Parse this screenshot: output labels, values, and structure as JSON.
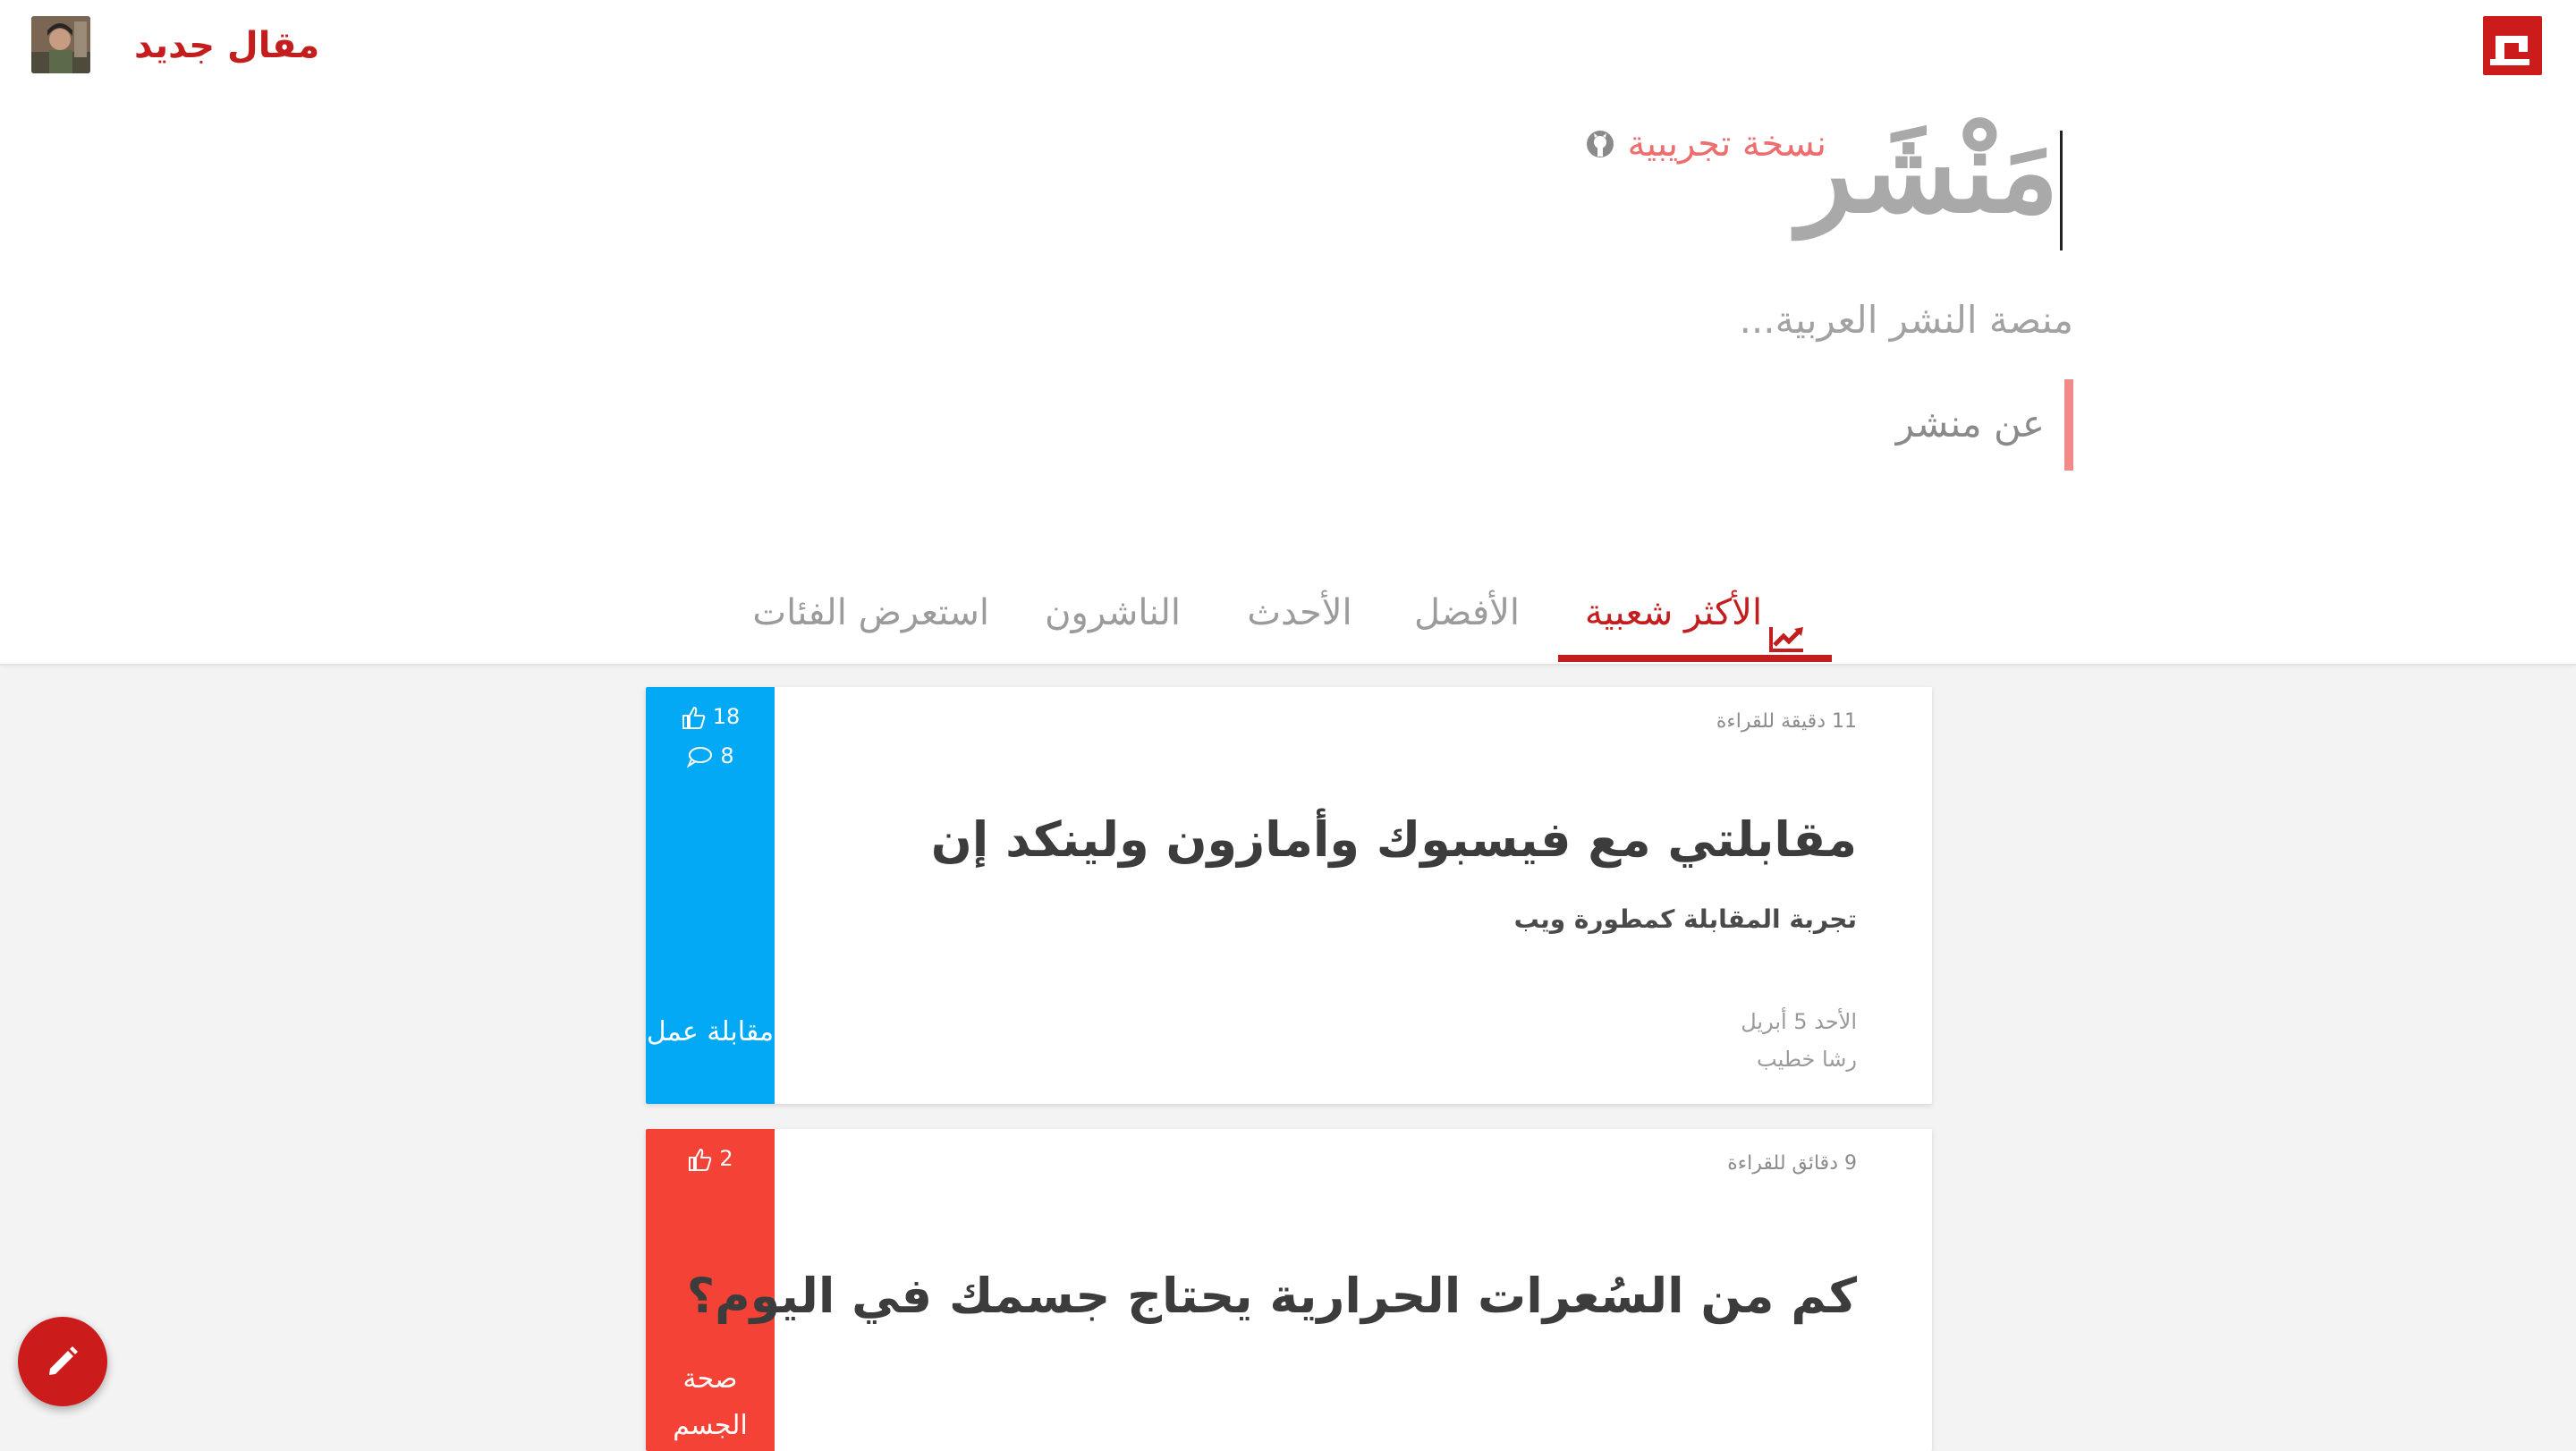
{
  "topbar": {
    "new_article_label": "مقال جديد",
    "brand_icon": "manshar-logo-icon",
    "avatar_icon": "user-avatar"
  },
  "hero": {
    "title": "مَنْشَر",
    "beta_label": "نسخة تجريبية",
    "tagline": "منصة النشر العربية...",
    "about_label": "عن منشر"
  },
  "tabs": [
    {
      "label": "الأكثر شعبية",
      "active": true,
      "icon": "trending-icon"
    },
    {
      "label": "الأفضل",
      "active": false
    },
    {
      "label": "الأحدث",
      "active": false
    },
    {
      "label": "الناشرون",
      "active": false
    },
    {
      "label": "استعرض الفئات",
      "active": false
    }
  ],
  "articles": [
    {
      "read_time": "11 دقيقة للقراءة",
      "title": "مقابلتي مع فيسبوك وأمازون ولينكد إن",
      "subtitle": "تجربة المقابلة كمطورة ويب",
      "date": "الأحد 5 أبريل",
      "author": "رشا خطيب",
      "likes": "18",
      "comments": "8",
      "category": "مقابلة عمل",
      "color": "#03a9f4"
    },
    {
      "read_time": "9 دقائق للقراءة",
      "title": "كم من السُعرات الحرارية يحتاج جسمك في اليوم؟",
      "likes": "2",
      "category": "صحة الجسم",
      "color": "#f44336"
    }
  ],
  "colors": {
    "brand": "#cc1b1b",
    "beta": "#ec6e6e",
    "about_border": "#f28a8a"
  },
  "fab": {
    "icon": "pencil-icon"
  }
}
